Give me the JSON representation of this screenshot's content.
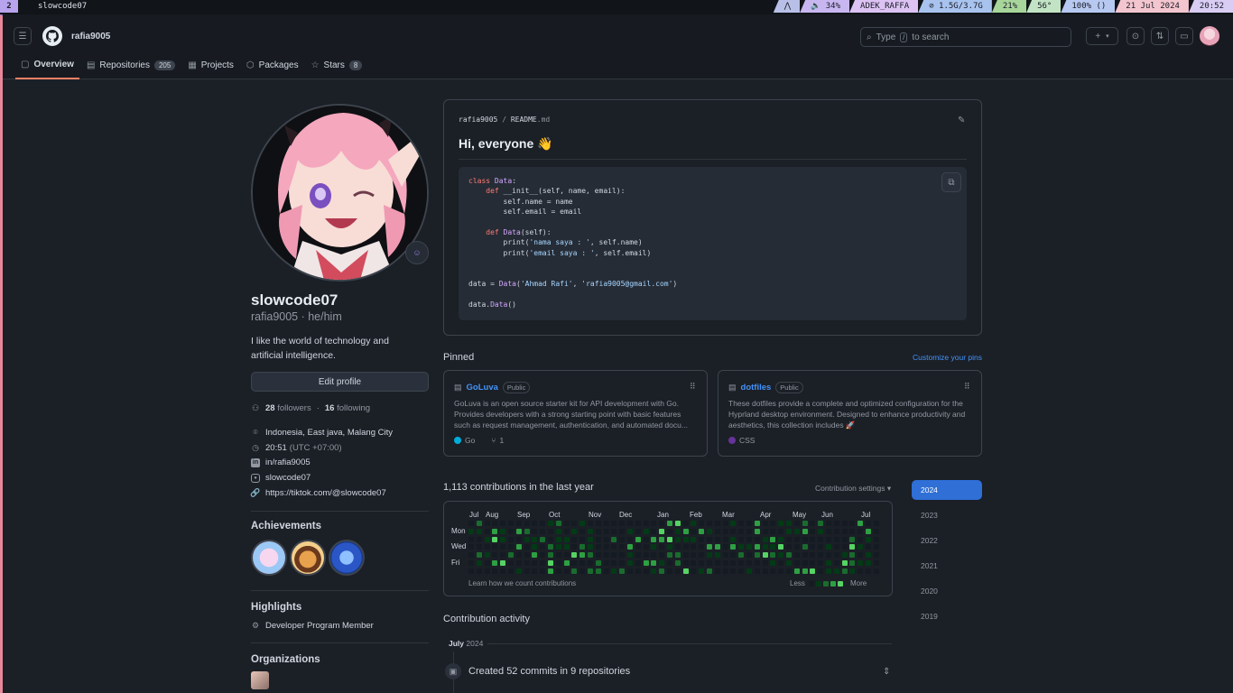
{
  "sysbar": {
    "workspace": "2",
    "window_title": "slowcode07",
    "segments": [
      {
        "name": "arch",
        "text": "⋀",
        "color": "#b8c0e8"
      },
      {
        "name": "volume",
        "text": "🔈 34%",
        "color": "#c8b6f0"
      },
      {
        "name": "wifi",
        "text": "ADEK_RAFFA",
        "color": "#dcc3f3"
      },
      {
        "name": "memory",
        "text": "⊘ 1.5G/3.7G",
        "color": "#a9c3ef"
      },
      {
        "name": "cpu",
        "text": "21%",
        "color": "#a7d59a"
      },
      {
        "name": "temp",
        "text": "56°",
        "color": "#c2e4c4"
      },
      {
        "name": "battery",
        "text": "100% ()",
        "color": "#b7c9f0"
      },
      {
        "name": "date",
        "text": "21 Jul 2024",
        "color": "#f3c6cf"
      },
      {
        "name": "time",
        "text": "20:52",
        "color": "#d9cdf4"
      }
    ]
  },
  "header": {
    "username": "rafia9005",
    "search_placeholder": "Type",
    "search_key": "/",
    "search_suffix": "to search"
  },
  "tabs": [
    {
      "label": "Overview",
      "icon": "book-icon",
      "active": true
    },
    {
      "label": "Repositories",
      "icon": "repo-icon",
      "count": "205"
    },
    {
      "label": "Projects",
      "icon": "table-icon"
    },
    {
      "label": "Packages",
      "icon": "package-icon"
    },
    {
      "label": "Stars",
      "icon": "star-icon",
      "count": "8"
    }
  ],
  "profile": {
    "name": "slowcode07",
    "login_pronouns": "rafia9005 · he/him",
    "bio_line1": "I like the world of technology and",
    "bio_line2": "artificial intelligence.",
    "edit_label": "Edit profile",
    "followers": "28",
    "followers_label": "followers",
    "following": "16",
    "following_label": "following",
    "location": "Indonesia, East java, Malang City",
    "local_time": "20:51",
    "timezone": "(UTC +07:00)",
    "linkedin": "in/rafia9005",
    "instagram": "slowcode07",
    "website": "https://tiktok.com/@slowcode07",
    "achievements_title": "Achievements",
    "highlights_title": "Highlights",
    "highlight_item": "Developer Program Member",
    "organizations_title": "Organizations"
  },
  "readme": {
    "path_user": "rafia9005",
    "path_sep": "/",
    "path_file": "README",
    "path_ext": ".md",
    "heading": "Hi, everyone 👋"
  },
  "pinned": {
    "title": "Pinned",
    "customize": "Customize your pins",
    "repos": [
      {
        "name": "GoLuva",
        "visibility": "Public",
        "desc": "GoLuva is an open source starter kit for API development with Go. Provides developers with a strong starting point with basic features such as request management, authentication, and automated docu...",
        "lang": "Go",
        "lang_color": "#00add8",
        "forks": "1"
      },
      {
        "name": "dotfiles",
        "visibility": "Public",
        "desc": "These dotfiles provide a complete and optimized configuration for the Hyprland desktop environment. Designed to enhance productivity and aesthetics, this collection includes 🚀",
        "lang": "CSS",
        "lang_color": "#663399"
      }
    ]
  },
  "contributions": {
    "title": "1,113 contributions in the last year",
    "settings": "Contribution settings ▾",
    "months": [
      "Jul",
      "Aug",
      "Sep",
      "Oct",
      "Nov",
      "Dec",
      "Jan",
      "Feb",
      "Mar",
      "Apr",
      "May",
      "Jun",
      "Jul"
    ],
    "days": [
      "Mon",
      "Wed",
      "Fri"
    ],
    "learn": "Learn how we count contributions",
    "less": "Less",
    "more": "More",
    "years": [
      "2024",
      "2023",
      "2022",
      "2021",
      "2020",
      "2019"
    ],
    "colors": [
      "#151b23",
      "#033a16",
      "#196c2e",
      "#2ea043",
      "#56d364"
    ]
  },
  "activity": {
    "title": "Contribution activity",
    "month": "July",
    "year": "2024",
    "item": "Created 52 commits in 9 repositories"
  },
  "colors": {
    "accent": "#f78166",
    "link": "#4493f8",
    "selected_year": "#2f6fd6"
  }
}
